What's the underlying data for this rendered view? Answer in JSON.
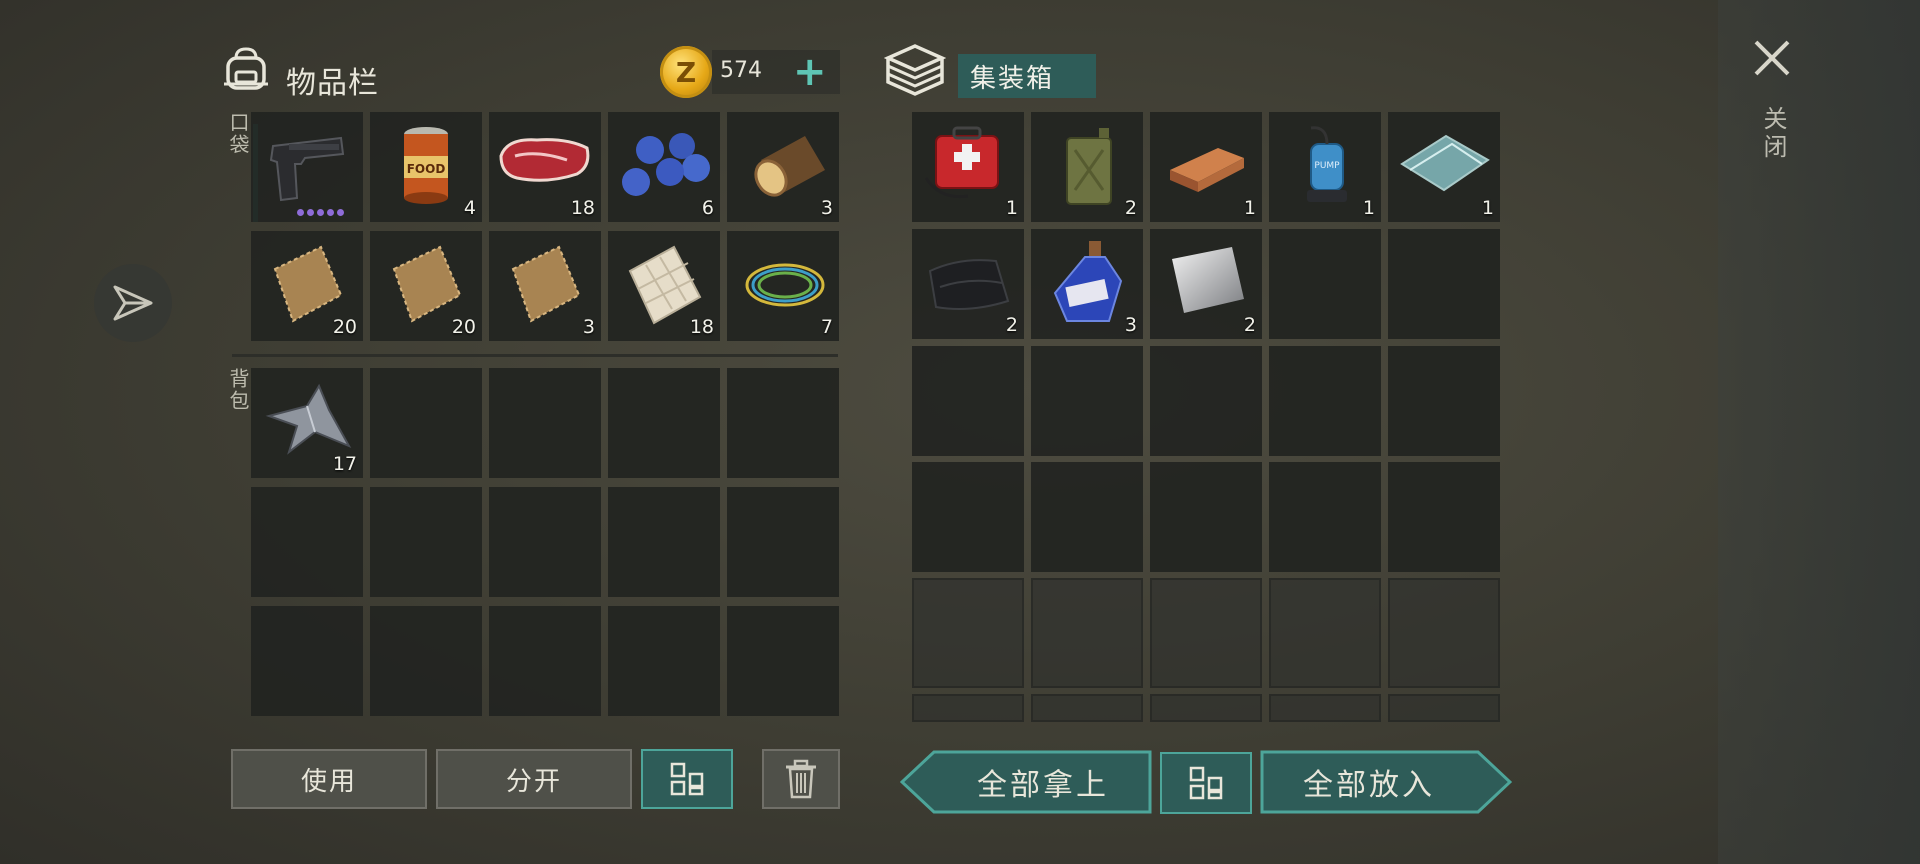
{
  "inventory": {
    "title": "物品栏",
    "money": "574"
  },
  "container": {
    "title": "集装箱"
  },
  "close_label": "关闭",
  "sections": {
    "pockets": "口袋",
    "backpack": "背包"
  },
  "buttons": {
    "use": "使用",
    "split": "分开",
    "take_all": "全部拿上",
    "put_all": "全部放入"
  },
  "pocket_items": [
    {
      "name": "pistol",
      "qty": ""
    },
    {
      "name": "canned food",
      "qty": "4"
    },
    {
      "name": "raw meat",
      "qty": "18"
    },
    {
      "name": "blueberries",
      "qty": "6"
    },
    {
      "name": "log",
      "qty": "3"
    },
    {
      "name": "fiber bundle",
      "qty": "20"
    },
    {
      "name": "fiber bundle",
      "qty": "20"
    },
    {
      "name": "fiber bundle",
      "qty": "3"
    },
    {
      "name": "cloth",
      "qty": "18"
    },
    {
      "name": "wire",
      "qty": "7"
    }
  ],
  "backpack_items": [
    {
      "name": "scrap metal",
      "qty": "17"
    }
  ],
  "container_items": [
    {
      "name": "first aid kit",
      "qty": "1"
    },
    {
      "name": "jerry can",
      "qty": "2"
    },
    {
      "name": "copper ingot",
      "qty": "1"
    },
    {
      "name": "water pump",
      "qty": "1"
    },
    {
      "name": "glass",
      "qty": "1"
    },
    {
      "name": "black cloth",
      "qty": "2"
    },
    {
      "name": "bottle",
      "qty": "3"
    },
    {
      "name": "metal sheet",
      "qty": "2"
    }
  ],
  "colors": {
    "accent": "#2e5c58",
    "accent_border": "#4da59a",
    "plus": "#5ec5b4",
    "rarity_dot": "#8e6cd8"
  }
}
